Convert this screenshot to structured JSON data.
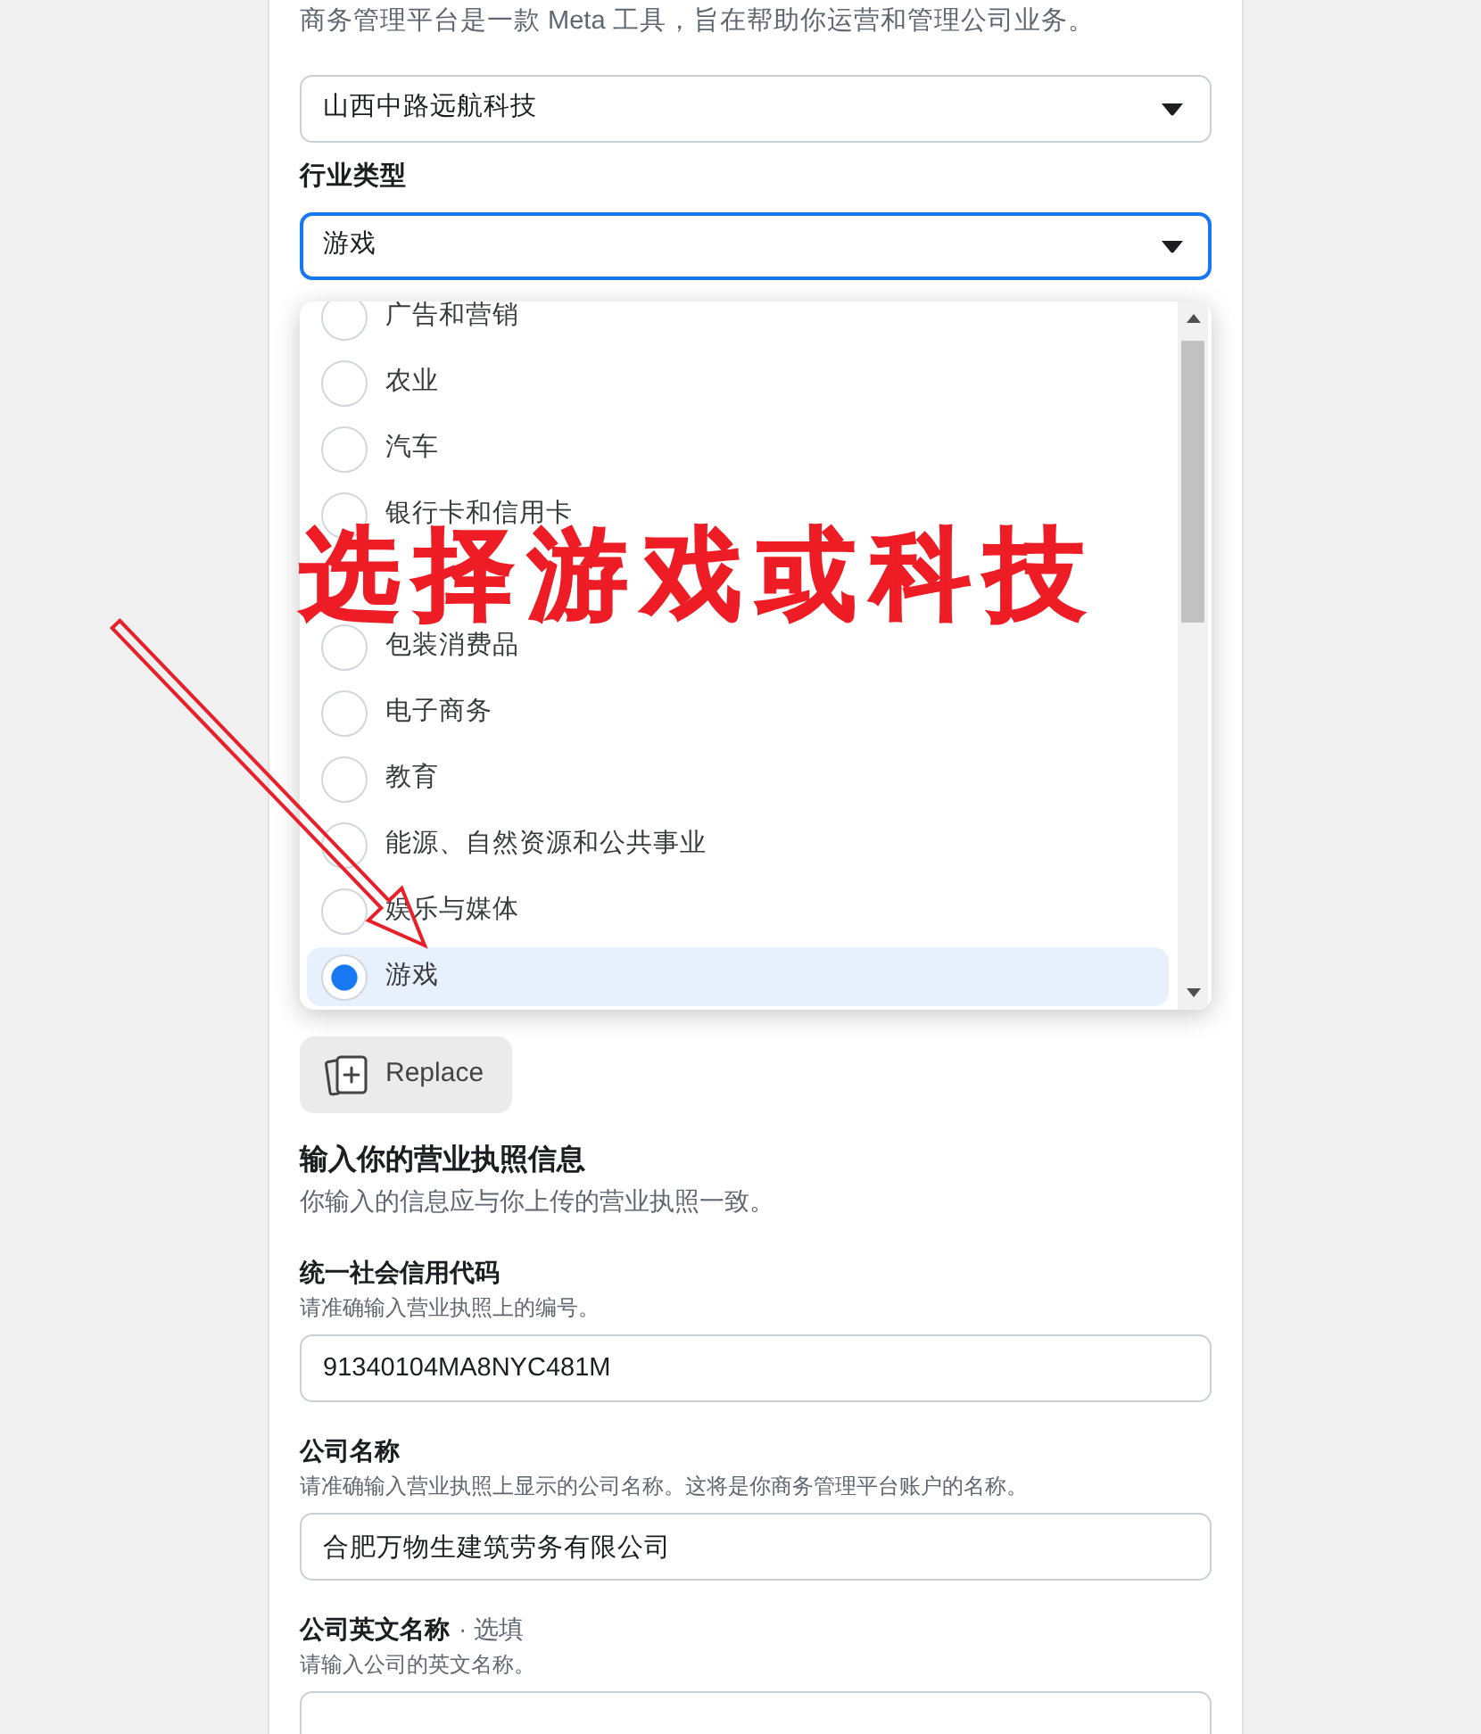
{
  "intro": {
    "text": "商务管理平台是一款 Meta 工具，旨在帮助你运营和管理公司业务。"
  },
  "business": {
    "value": "山西中路远航科技",
    "focused": false
  },
  "industry": {
    "label": "行业类型",
    "value": "游戏",
    "focused": true,
    "expanded": true,
    "options": [
      {
        "kind": "radio",
        "label": "广告和营销",
        "selected": false
      },
      {
        "kind": "radio",
        "label": "农业",
        "selected": false
      },
      {
        "kind": "radio",
        "label": "汽车",
        "selected": false
      },
      {
        "kind": "radio",
        "label": "银行卡和信用卡",
        "selected": false
      },
      {
        "kind": "covered"
      },
      {
        "kind": "radio",
        "label": "包装消费品",
        "selected": false
      },
      {
        "kind": "radio",
        "label": "电子商务",
        "selected": false
      },
      {
        "kind": "radio",
        "label": "教育",
        "selected": false
      },
      {
        "kind": "radio",
        "label": "能源、自然资源和公共事业",
        "selected": false
      },
      {
        "kind": "radio",
        "label": "娱乐与媒体",
        "selected": false
      },
      {
        "kind": "radio",
        "label": "游戏",
        "selected": true
      }
    ]
  },
  "annotation": {
    "text": "选择游戏或科技"
  },
  "replace_button": {
    "label": "Replace"
  },
  "license": {
    "title": "输入你的营业执照信息",
    "subtitle": "你输入的信息应与你上传的营业执照一致。",
    "fields": [
      {
        "label": "统一社会信用代码",
        "hint": "请准确输入营业执照上的编号。",
        "value": "91340104MA8NYC481M"
      },
      {
        "label": "公司名称",
        "hint": "请准确输入营业执照上显示的公司名称。这将是你商务管理平台账户的名称。",
        "value": "合肥万物生建筑劳务有限公司"
      },
      {
        "label": "公司英文名称",
        "optional": "· 选填",
        "hint": "请输入公司的英文名称。"
      }
    ]
  }
}
